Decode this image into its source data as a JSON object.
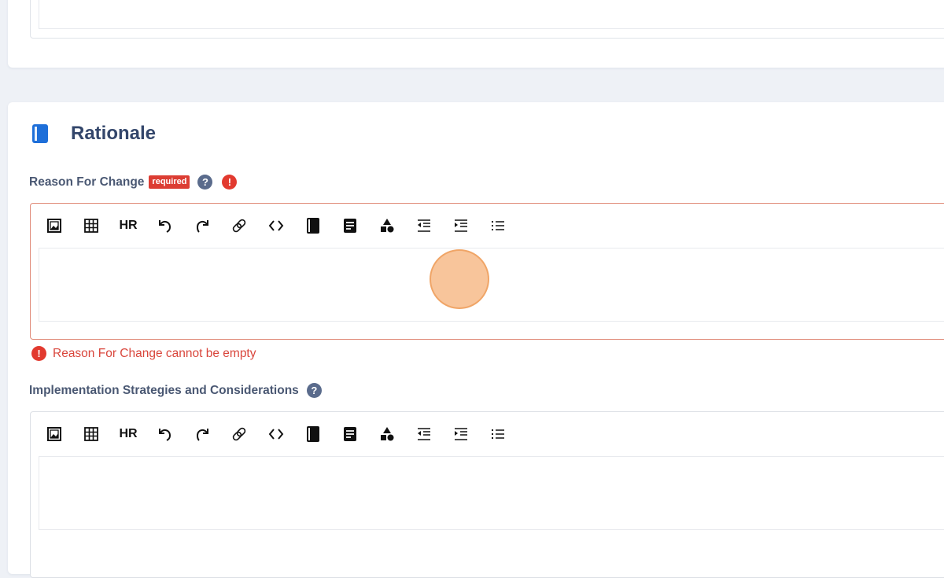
{
  "section": {
    "title": "Rationale",
    "icon": "book-icon",
    "icon_color": "#1e6fd9"
  },
  "fields": [
    {
      "label": "Reason For Change",
      "required_badge": "required",
      "help": "?",
      "error": true,
      "error_message": "Reason For Change cannot be empty",
      "value": ""
    },
    {
      "label": "Implementation Strategies and Considerations",
      "help": "?",
      "error": false,
      "value": ""
    }
  ],
  "toolbar": {
    "buttons": [
      {
        "name": "insert-image",
        "icon": "image-icon"
      },
      {
        "name": "insert-table",
        "icon": "table-icon"
      },
      {
        "name": "horizontal-rule",
        "label": "HR"
      },
      {
        "name": "undo",
        "icon": "undo-icon"
      },
      {
        "name": "redo",
        "icon": "redo-icon"
      },
      {
        "name": "link",
        "icon": "link-icon"
      },
      {
        "name": "code",
        "icon": "code-icon"
      },
      {
        "name": "book",
        "icon": "book-icon"
      },
      {
        "name": "document",
        "icon": "document-icon"
      },
      {
        "name": "shapes",
        "icon": "shapes-icon"
      },
      {
        "name": "outdent",
        "icon": "outdent-icon"
      },
      {
        "name": "indent",
        "icon": "indent-icon"
      },
      {
        "name": "bullet-list",
        "icon": "list-icon"
      }
    ]
  },
  "colors": {
    "error": "#d9463c",
    "badge": "#dc3d33",
    "title": "#33466b",
    "pointer": "#f6b27a"
  }
}
